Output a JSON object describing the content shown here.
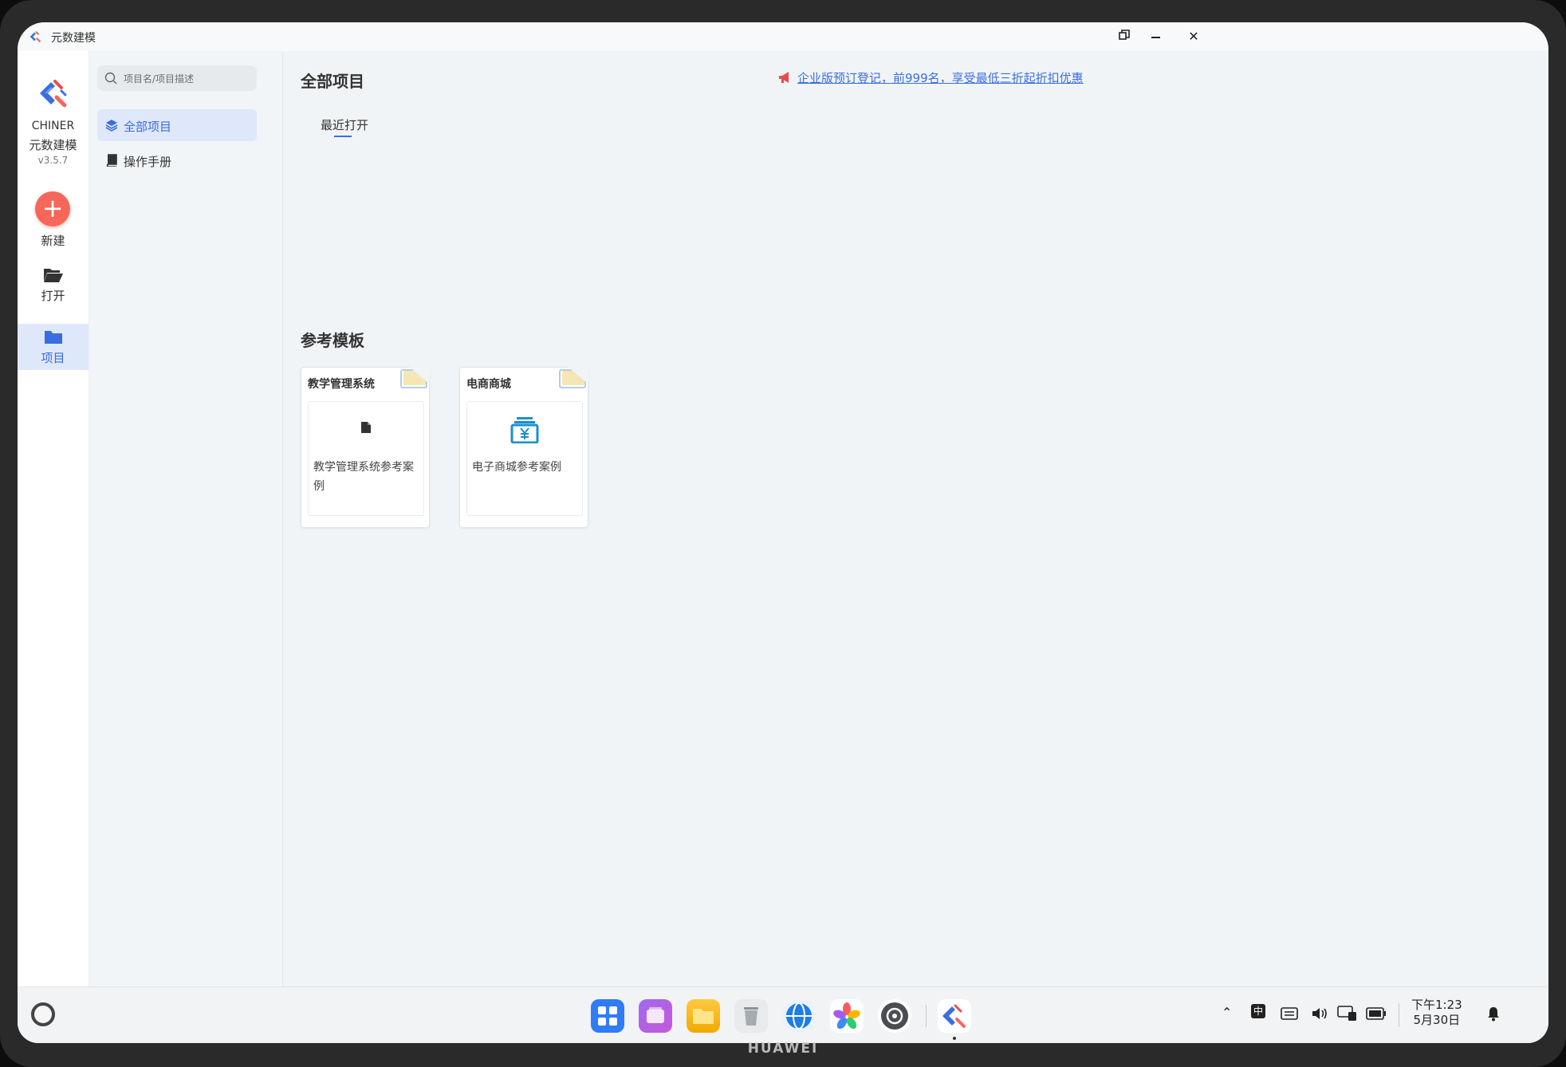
{
  "window": {
    "title": "元数建模"
  },
  "brand": {
    "name": "CHINER",
    "subtitle": "元数建模",
    "version": "v3.5.7"
  },
  "leftnav": {
    "new_label": "新建",
    "open_label": "打开",
    "project_label": "项目"
  },
  "search": {
    "placeholder": "项目名/项目描述"
  },
  "sidebar": {
    "items": [
      {
        "label": "全部项目",
        "icon": "layers-icon",
        "active": true
      },
      {
        "label": "操作手册",
        "icon": "book-icon",
        "active": false
      }
    ]
  },
  "main": {
    "title": "全部项目",
    "promo": "企业版预订登记，前999名，享受最低三折起折扣优惠",
    "tabs": [
      {
        "label": "最近打开"
      }
    ],
    "templates_title": "参考模板",
    "templates": [
      {
        "title": "教学管理系统",
        "desc": "教学管理系统参考案例",
        "icon": "file-icon"
      },
      {
        "title": "电商商城",
        "desc": "电子商城参考案例",
        "icon": "yuan-box-icon"
      }
    ]
  },
  "taskbar": {
    "dock": [
      "app-grid-icon",
      "multitask-icon",
      "files-icon",
      "trash-icon",
      "browser-icon",
      "gallery-icon",
      "settings-icon",
      "chiner-icon"
    ],
    "ime": "中",
    "time": "下午1:23",
    "date": "5月30日"
  },
  "device": {
    "brand": "HUAWEI"
  },
  "colors": {
    "accent": "#3a6de0",
    "new_button": "#f5675a",
    "main_bg": "#f1f4f6"
  }
}
